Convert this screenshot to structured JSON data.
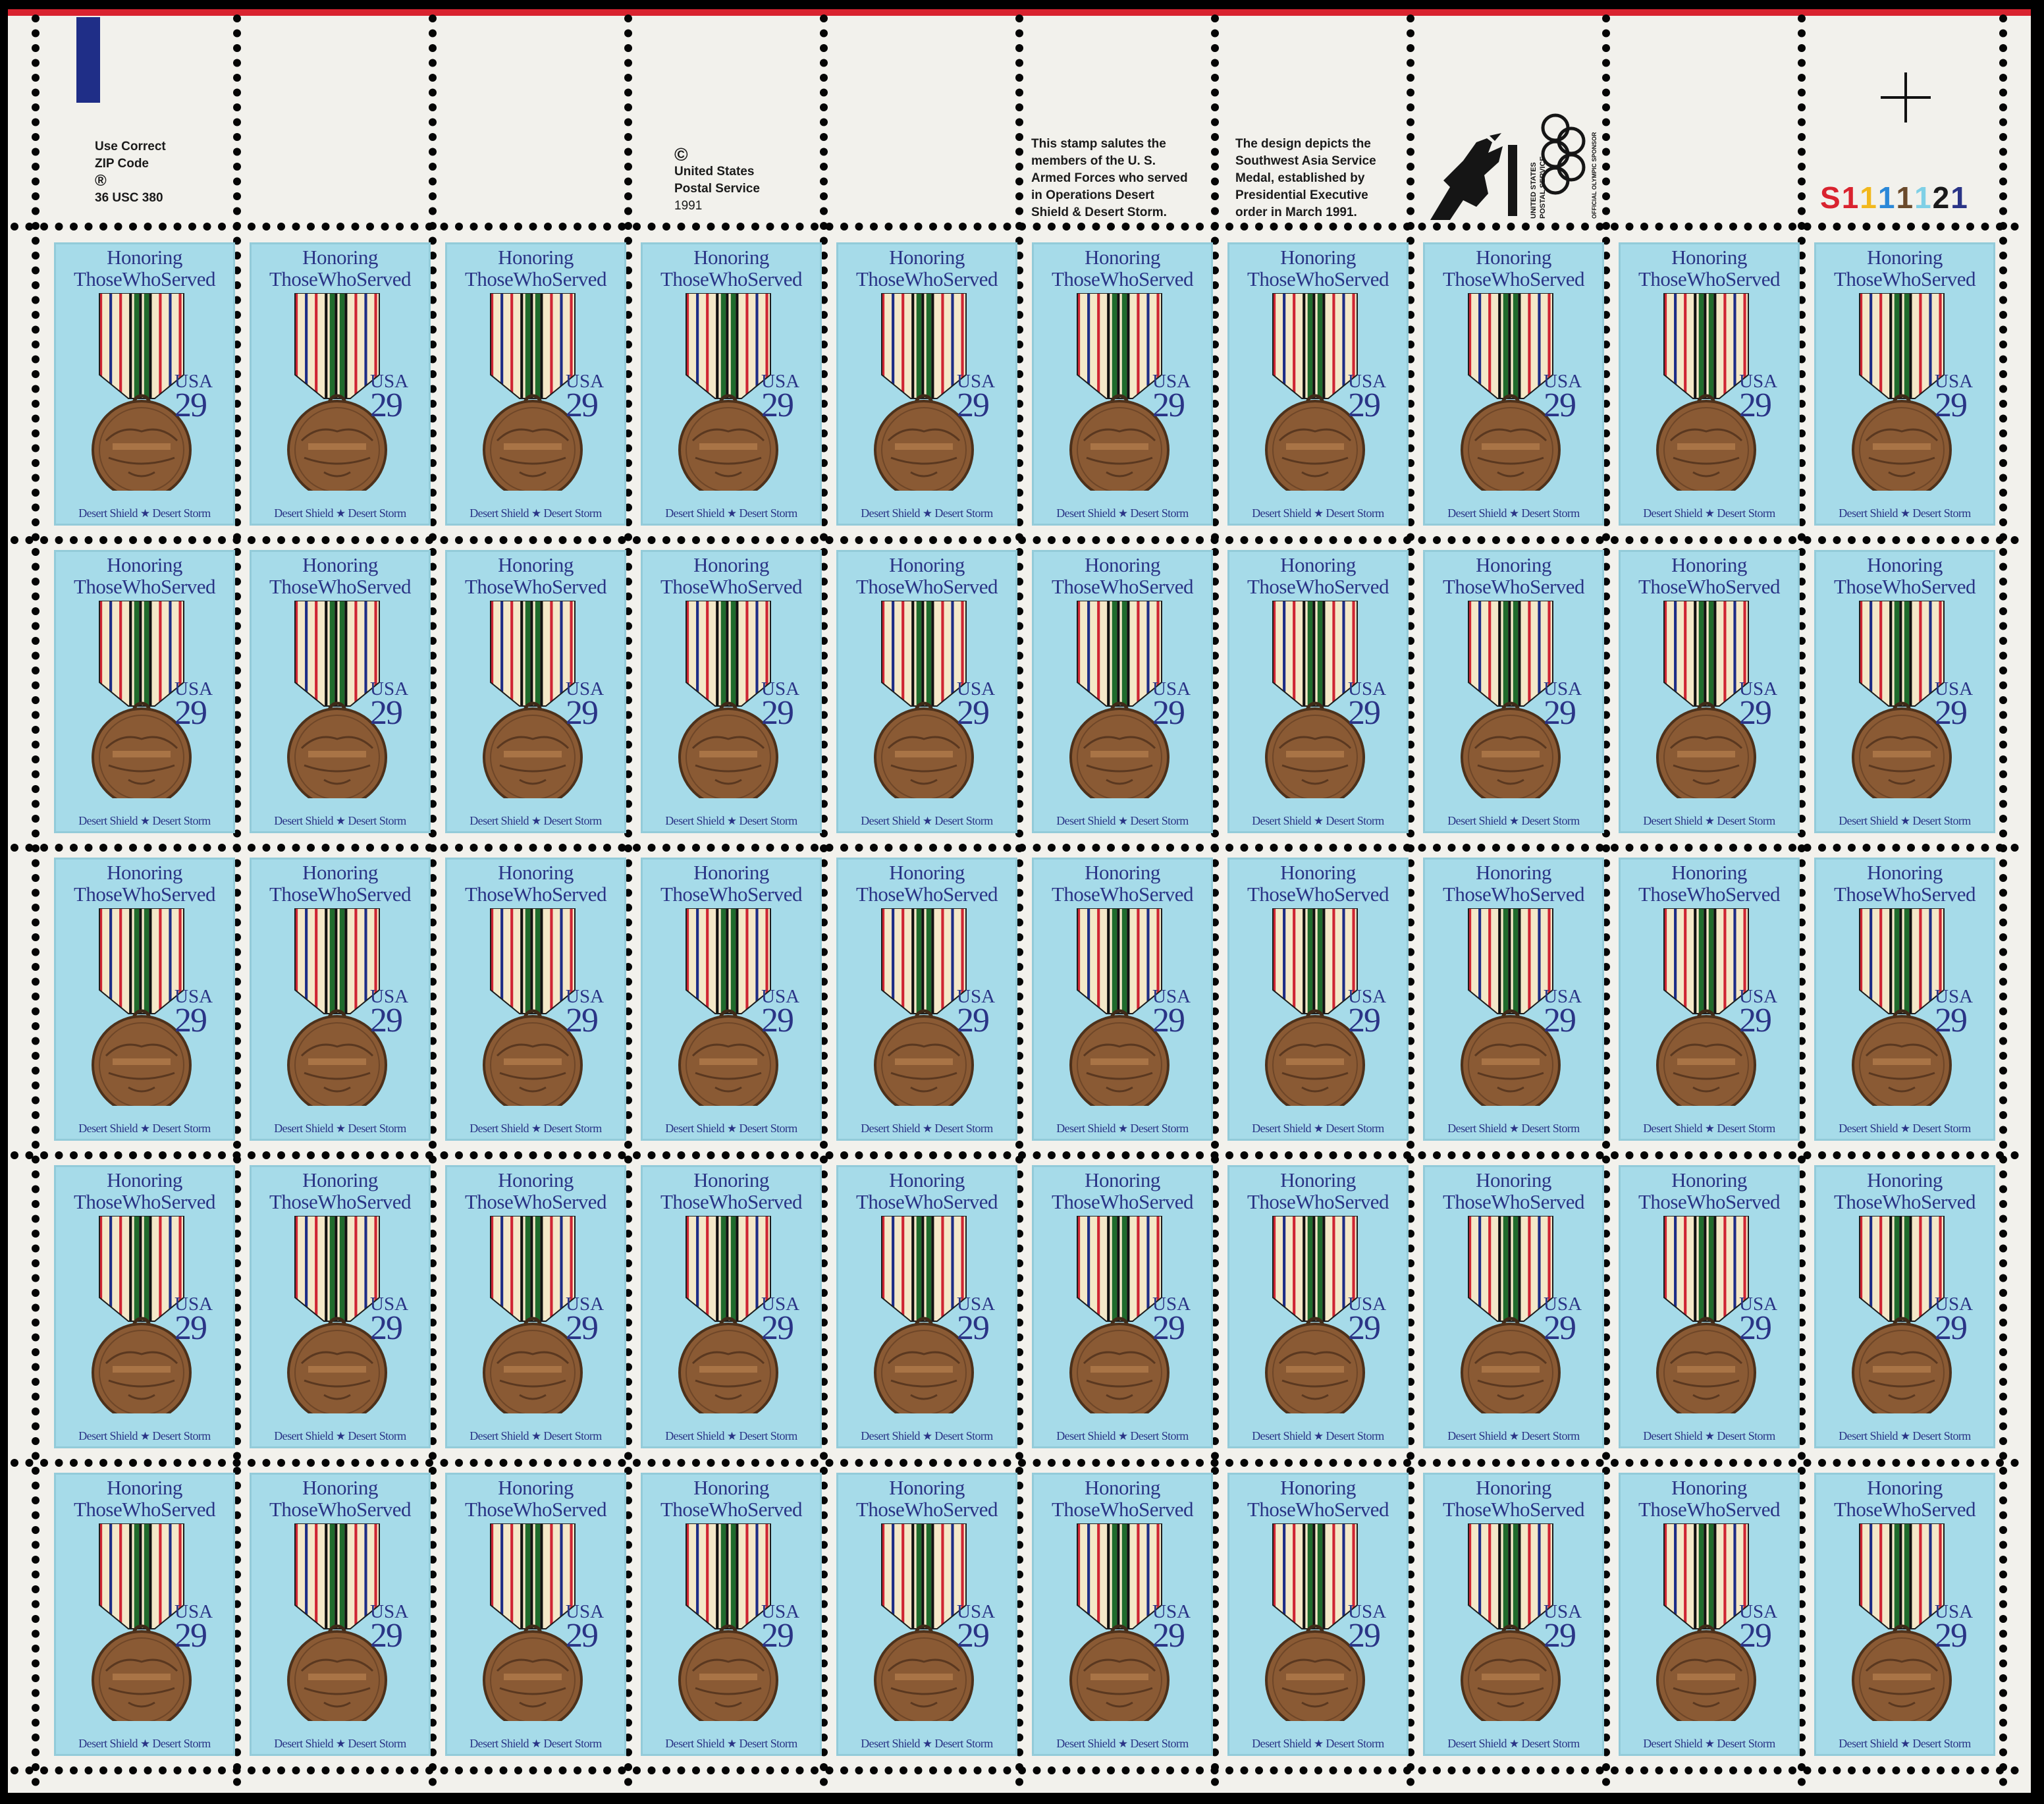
{
  "margin": {
    "zip_notice": [
      "Use Correct",
      "ZIP Code",
      "®",
      "36 USC 380"
    ],
    "copyright": [
      "©",
      "United States",
      "Postal Service",
      "1991"
    ],
    "salute_text": [
      "This stamp salutes the",
      "members of the U. S.",
      "Armed Forces who served",
      "in Operations Desert",
      "Shield & Desert Storm."
    ],
    "design_text": [
      "The design depicts the",
      "Southwest Asia Service",
      "Medal, established by",
      "Presidential Executive",
      "order in March 1991."
    ],
    "logo_label_1": "UNITED STATES",
    "logo_label_2": "POSTAL SERVICE",
    "logo_label_3": "OFFICIAL OLYMPIC SPONSOR",
    "plate_number": [
      {
        "text": "S",
        "color": "#d9232f"
      },
      {
        "text": "1",
        "color": "#d9232f"
      },
      {
        "text": "1",
        "color": "#f2b81d"
      },
      {
        "text": "1",
        "color": "#2b88d8"
      },
      {
        "text": "1",
        "color": "#6b4a2b"
      },
      {
        "text": "1",
        "color": "#7fd0e6"
      },
      {
        "text": "2",
        "color": "#1a1a1a"
      },
      {
        "text": "1",
        "color": "#2a3486"
      }
    ]
  },
  "colors": {
    "sheet": "#f2f1ec",
    "red_line": "#d9232f",
    "blue_line": "#1f2e87",
    "stamp_background": "#a6dbe9",
    "stamp_text": "#2a3486",
    "medal_bronze": "#8a5a34"
  },
  "stamp": {
    "title_line1": "Honoring",
    "title_line2": "ThoseWhoServed",
    "country": "USA",
    "value": "29",
    "caption_left": "Desert Shield",
    "caption_right": "Desert Storm",
    "medal_inscription": "SOUTHWEST ASIA SERVICE"
  },
  "grid": {
    "rows": 5,
    "columns": 10
  }
}
